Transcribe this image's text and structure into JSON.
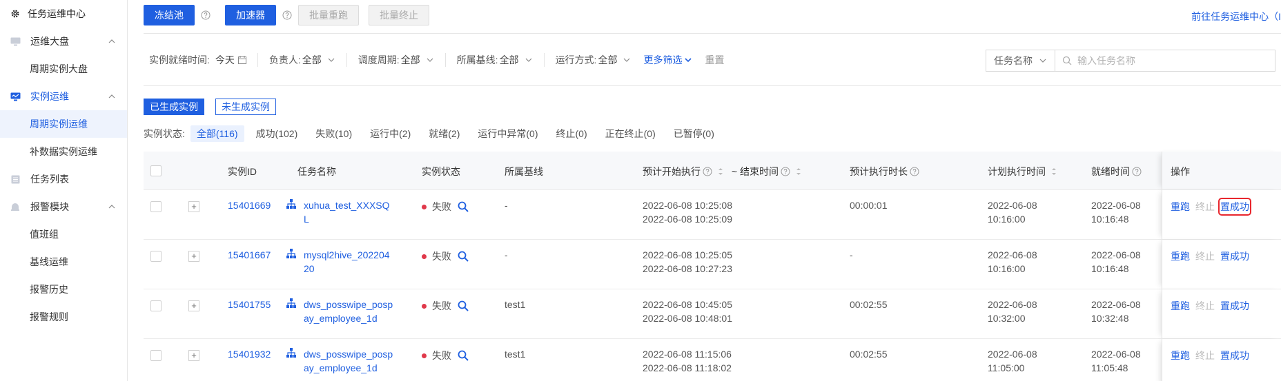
{
  "sidebar": {
    "title": "任务运维中心",
    "groups": [
      {
        "label": "运维大盘",
        "children": [
          "周期实例大盘"
        ]
      },
      {
        "label": "实例运维",
        "children": [
          "周期实例运维",
          "补数据实例运维"
        ]
      },
      {
        "label": "任务列表",
        "children": []
      },
      {
        "label": "报警模块",
        "children": [
          "值班组",
          "基线运维",
          "报警历史",
          "报警规则"
        ]
      }
    ]
  },
  "toolbar": {
    "freeze_pool": "冻结池",
    "accelerator": "加速器",
    "batch_rerun": "批量重跑",
    "batch_stop": "批量终止",
    "top_link": "前往任务运维中心（I"
  },
  "filters": {
    "ready_time_label": "实例就绪时间:",
    "ready_time_value": "今天",
    "owner_label": "负责人:",
    "owner_value": "全部",
    "cycle_label": "调度周期:",
    "cycle_value": "全部",
    "baseline_label": "所属基线:",
    "baseline_value": "全部",
    "run_mode_label": "运行方式:",
    "run_mode_value": "全部",
    "more": "更多筛选",
    "reset": "重置"
  },
  "search": {
    "field": "任务名称",
    "placeholder": "输入任务名称"
  },
  "gen_tabs": {
    "generated": "已生成实例",
    "not_generated": "未生成实例"
  },
  "status_filter": {
    "label": "实例状态:",
    "options": [
      "全部(116)",
      "成功(102)",
      "失败(10)",
      "运行中(2)",
      "就绪(2)",
      "运行中异常(0)",
      "终止(0)",
      "正在终止(0)",
      "已暂停(0)"
    ]
  },
  "table": {
    "headers": {
      "id": "实例ID",
      "task": "任务名称",
      "status": "实例状态",
      "baseline": "所属基线",
      "expected_start": "预计开始执行",
      "end_time": "~ 结束时间",
      "expected_duration": "预计执行时长",
      "plan_time": "计划执行时间",
      "ready_time": "就绪时间",
      "ops": "操作"
    },
    "rows": [
      {
        "id": "15401669",
        "task": "xuhua_test_XXXSQL",
        "status": "失败",
        "baseline": "-",
        "start": "2022-06-08 10:25:08",
        "end": "2022-06-08 10:25:09",
        "duration": "00:00:01",
        "plan_date": "2022-06-08",
        "plan_time": "10:16:00",
        "ready_date": "2022-06-08",
        "ready_time": "10:16:48"
      },
      {
        "id": "15401667",
        "task": "mysql2hive_20220420",
        "status": "失败",
        "baseline": "-",
        "start": "2022-06-08 10:25:05",
        "end": "2022-06-08 10:27:23",
        "duration": "-",
        "plan_date": "2022-06-08",
        "plan_time": "10:16:00",
        "ready_date": "2022-06-08",
        "ready_time": "10:16:48"
      },
      {
        "id": "15401755",
        "task": "dws_posswipe_pospay_employee_1d",
        "status": "失败",
        "baseline": "test1",
        "start": "2022-06-08 10:45:05",
        "end": "2022-06-08 10:48:01",
        "duration": "00:02:55",
        "plan_date": "2022-06-08",
        "plan_time": "10:32:00",
        "ready_date": "2022-06-08",
        "ready_time": "10:32:48"
      },
      {
        "id": "15401932",
        "task": "dws_posswipe_pospay_employee_1d",
        "status": "失败",
        "baseline": "test1",
        "start": "2022-06-08 11:15:06",
        "end": "2022-06-08 11:18:02",
        "duration": "00:02:55",
        "plan_date": "2022-06-08",
        "plan_time": "11:05:00",
        "ready_date": "2022-06-08",
        "ready_time": "11:05:48"
      }
    ],
    "actions": {
      "rerun": "重跑",
      "stop": "终止",
      "set_success": "置成功"
    }
  },
  "colors": {
    "primary": "#1f5fe0",
    "failed": "#e0384a",
    "highlight": "#e8272e"
  }
}
